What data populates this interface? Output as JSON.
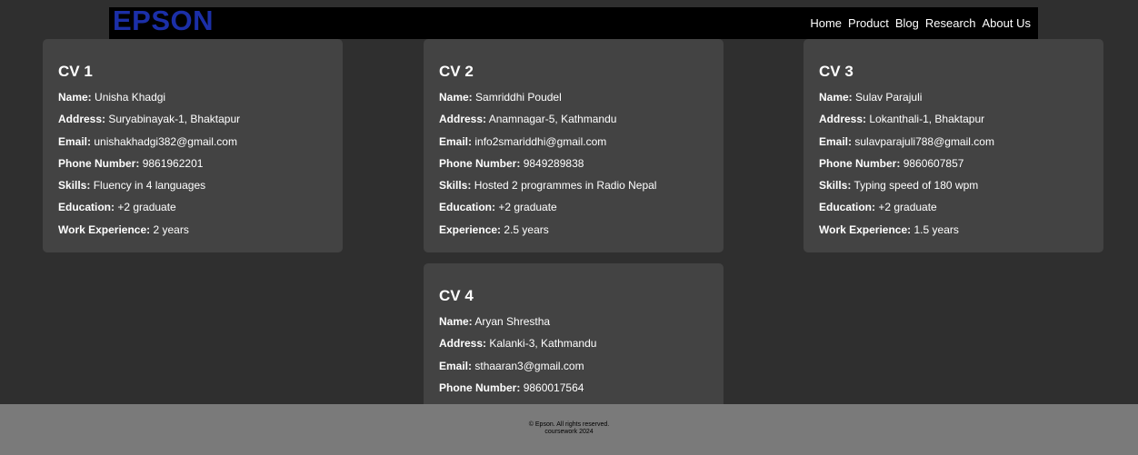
{
  "header": {
    "logo": "EPSON",
    "nav": [
      "Home",
      "Product",
      "Blog",
      "Research",
      "About Us"
    ]
  },
  "cards": [
    {
      "title": "CV 1",
      "rows": [
        {
          "label": "Name:",
          "value": "Unisha Khadgi"
        },
        {
          "label": "Address:",
          "value": "Suryabinayak-1, Bhaktapur"
        },
        {
          "label": "Email:",
          "value": "unishakhadgi382@gmail.com"
        },
        {
          "label": "Phone Number:",
          "value": "9861962201"
        },
        {
          "label": "Skills:",
          "value": "Fluency in 4 languages"
        },
        {
          "label": "Education:",
          "value": "+2 graduate"
        },
        {
          "label": "Work Experience:",
          "value": "2 years"
        }
      ]
    },
    {
      "title": "CV 2",
      "rows": [
        {
          "label": "Name:",
          "value": "Samriddhi Poudel"
        },
        {
          "label": "Address:",
          "value": "Anamnagar-5, Kathmandu"
        },
        {
          "label": "Email:",
          "value": "info2smariddhi@gmail.com"
        },
        {
          "label": "Phone Number:",
          "value": "9849289838"
        },
        {
          "label": "Skills:",
          "value": "Hosted 2 programmes in Radio Nepal"
        },
        {
          "label": "Education:",
          "value": "+2 graduate"
        },
        {
          "label": "Experience:",
          "value": "2.5 years"
        }
      ]
    },
    {
      "title": "CV 3",
      "rows": [
        {
          "label": "Name:",
          "value": "Sulav Parajuli"
        },
        {
          "label": "Address:",
          "value": "Lokanthali-1, Bhaktapur"
        },
        {
          "label": "Email:",
          "value": "sulavparajuli788@gmail.com"
        },
        {
          "label": "Phone Number:",
          "value": "9860607857"
        },
        {
          "label": "Skills:",
          "value": "Typing speed of 180 wpm"
        },
        {
          "label": "Education:",
          "value": "+2 graduate"
        },
        {
          "label": "Work Experience:",
          "value": "1.5 years"
        }
      ]
    },
    {
      "title": "CV 4",
      "rows": [
        {
          "label": "Name:",
          "value": "Aryan Shrestha"
        },
        {
          "label": "Address:",
          "value": "Kalanki-3, Kathmandu"
        },
        {
          "label": "Email:",
          "value": "sthaaran3@gmail.com"
        },
        {
          "label": "Phone Number:",
          "value": "9860017564"
        }
      ]
    }
  ],
  "footer": {
    "line1": "© Epson. All rights reserved.",
    "line2": "coursework 2024"
  },
  "colors": {
    "page_bg": "#2f2f2f",
    "card_bg": "#434343",
    "nav_bg": "#000000",
    "logo": "#1b2fa8",
    "footer_bg": "#7a7a7a"
  }
}
